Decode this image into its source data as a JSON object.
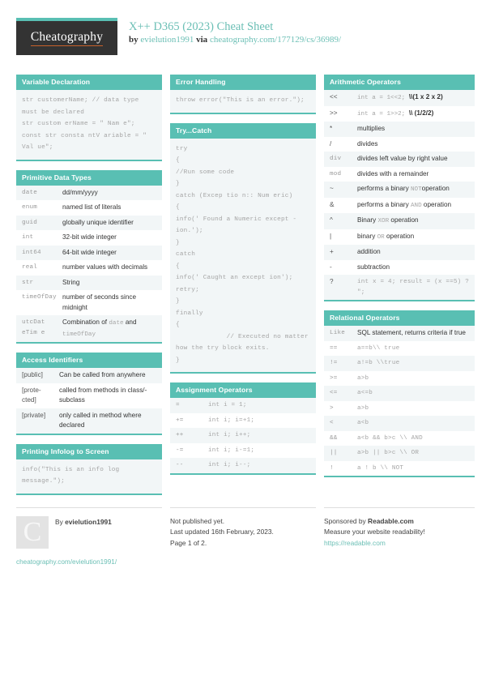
{
  "header": {
    "logo_text": "Cheatography",
    "title": "X++ D365 (2023) Cheat Sheet",
    "by_prefix": "by ",
    "author": "evielution1991",
    "via": " via ",
    "source_url": "cheatography.com/177129/cs/36989/"
  },
  "cards": {
    "variable_declaration": {
      "title": "Variable Declaration",
      "code": "str customerName; // data type must be declared\nstr custom erName = \" Nam e\";\nconst str consta ntV ariable = \" Val ue\";"
    },
    "primitive_data_types": {
      "title": "Primitive Data Types",
      "rows": [
        {
          "k": "date",
          "v": "dd/mm/yyyy"
        },
        {
          "k": "enum",
          "v": "named list of literals"
        },
        {
          "k": "guid",
          "v": "globally unique identifier"
        },
        {
          "k": "int",
          "v": "32-bit wide integer"
        },
        {
          "k": "int64",
          "v": "64-bit wide integer"
        },
        {
          "k": "real",
          "v": "number values with decimals"
        },
        {
          "k": "str",
          "v": "String"
        },
        {
          "k": "timeOfDay",
          "v": "number of seconds since midnight"
        },
        {
          "k": "utcDat eTim e",
          "v_pre": "Combination of ",
          "v_mono1": "date",
          "v_mid": " and ",
          "v_mono2": "timeOfDay"
        }
      ]
    },
    "access_identifiers": {
      "title": "Access Identifiers",
      "rows": [
        {
          "k": "[public]",
          "v": "Can be called from anywhere"
        },
        {
          "k": "[prote-cted]",
          "v": "called from methods in class/-subclass"
        },
        {
          "k": "[private]",
          "v": "only called in method where declared"
        }
      ]
    },
    "printing_infolog": {
      "title": "Printing Infolog to Screen",
      "code": "info(\"This is an info log message.\");"
    },
    "error_handling": {
      "title": "Error Handling",
      "code": "throw error(\"This is an error.\");"
    },
    "try_catch": {
      "title": "Try...Catch",
      "code": "try\n{\n//Run some code\n}\ncatch (Excep tio n:: Num eric)\n{\ninfo(' Found a Numeric except -ion.');\n}\ncatch\n{\ninfo(' Caught an except ion');\nretry;\n}\nfinally\n{\n             // Executed no matter how the try block exits.\n}"
    },
    "assignment_operators": {
      "title": "Assignment Operators",
      "rows": [
        {
          "k": "=",
          "v": "int i = 1;"
        },
        {
          "k": "+=",
          "v": "int i; i=+1;"
        },
        {
          "k": "++",
          "v": "int i; i++;"
        },
        {
          "k": "-=",
          "v": "int i; i-=1;"
        },
        {
          "k": "--",
          "v": "int i; i--;"
        }
      ]
    },
    "arithmetic_operators": {
      "title": "Arithmetic Operators",
      "rows": [
        {
          "k": "<<",
          "v_mono": "int a = 1<<2; ",
          "v_bold": "\\\\(1 x 2 x 2)"
        },
        {
          "k": ">>",
          "v_mono": "int a = 1>>2; ",
          "v_bold": "\\\\ (1/2/2)"
        },
        {
          "k": "*",
          "v": "multiplies"
        },
        {
          "k": "/",
          "v": "divides"
        },
        {
          "k": "div",
          "k_mono": true,
          "v": "divides left value by right value"
        },
        {
          "k": "mod",
          "k_mono": true,
          "v": "divides with a remainder"
        },
        {
          "k": "~",
          "v_pre": "performs a binary ",
          "v_mono1": "NOT",
          "v_post": "operation"
        },
        {
          "k": "&",
          "v_pre": "performs a binary ",
          "v_mono1": "AND",
          "v_post": " operation"
        },
        {
          "k": "^",
          "v_pre": "Binary ",
          "v_mono1": "XOR",
          "v_post": " operation"
        },
        {
          "k": "|",
          "v_pre": "binary ",
          "v_mono1": "OR",
          "v_post": " operation"
        },
        {
          "k": "+",
          "v": "addition"
        },
        {
          "k": "-",
          "v": "subtraction"
        },
        {
          "k": "?",
          "v_mono": "int x = 4; result = (x ==5) ? \";"
        }
      ]
    },
    "relational_operators": {
      "title": "Relational Operators",
      "rows": [
        {
          "k": "Like",
          "k_mono": true,
          "v": "SQL statement, returns criteria if true"
        },
        {
          "k": "==",
          "v_mono": "a==b\\\\ true"
        },
        {
          "k": "!=",
          "v_mono": "a!=b \\\\true"
        },
        {
          "k": ">=",
          "v_mono": "a>b"
        },
        {
          "k": "<=",
          "v_mono": "a<=b"
        },
        {
          "k": ">",
          "v_mono": "a>b"
        },
        {
          "k": "<",
          "v_mono": "a<b"
        },
        {
          "k": "&&",
          "v_mono": "a<b && b>c \\\\ AND"
        },
        {
          "k": "||",
          "v_mono": "a>b || b>c \\\\ OR"
        },
        {
          "k": "!",
          "v_mono": "a ! b \\\\ NOT"
        }
      ]
    }
  },
  "footer": {
    "avatar_letter": "C",
    "by_label": "By ",
    "author": "evielution1991",
    "author_url": "cheatography.com/evielution1991/",
    "publish_status": "Not published yet.",
    "last_updated": "Last updated 16th February, 2023.",
    "page_number": "Page 1 of 2.",
    "sponsor_prefix": "Sponsored by ",
    "sponsor_name": "Readable.com",
    "sponsor_tagline": "Measure your website readability!",
    "sponsor_url": "https://readable.com"
  }
}
